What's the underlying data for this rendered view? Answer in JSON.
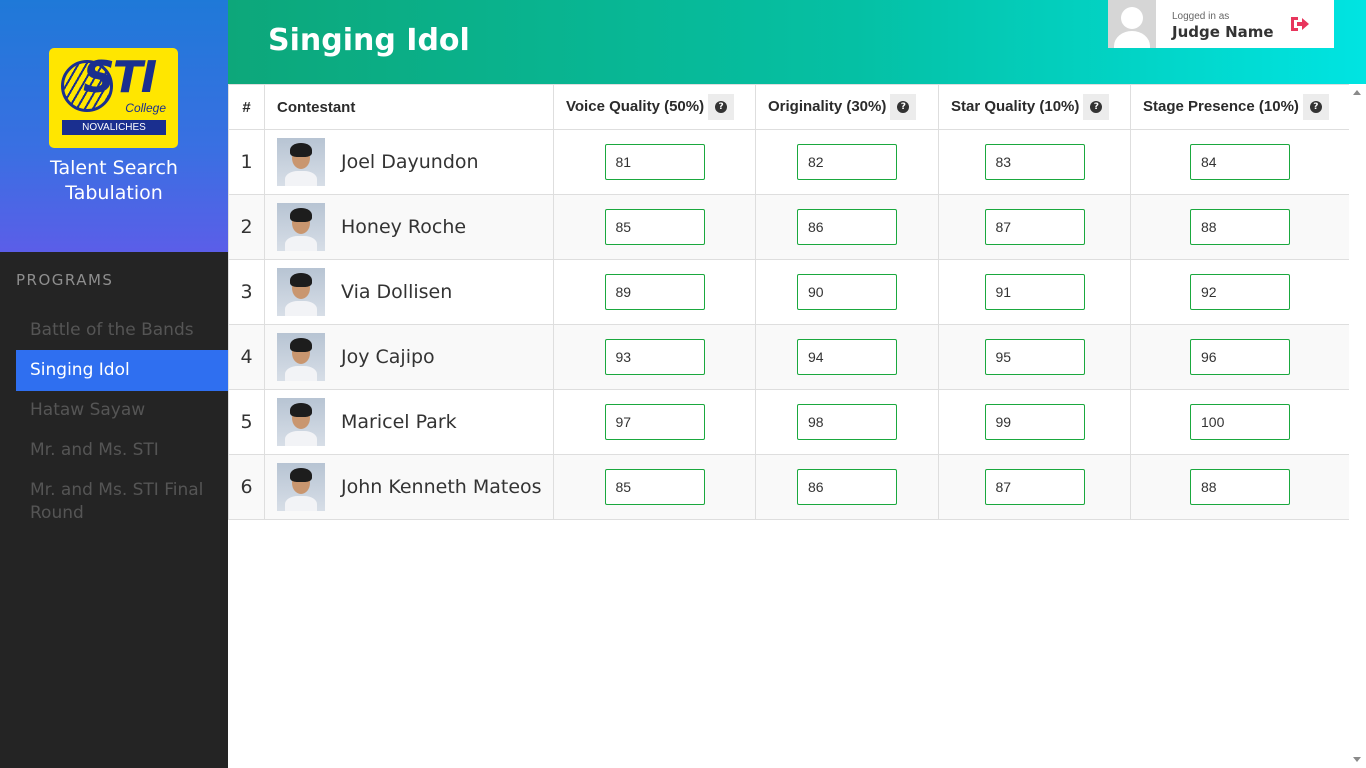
{
  "brand": {
    "logo_text": "STI",
    "logo_subtext": "College",
    "logo_campus": "NOVALICHES",
    "title_line1": "Talent Search",
    "title_line2": "Tabulation"
  },
  "sidebar": {
    "section_label": "PROGRAMS",
    "items": [
      {
        "label": "Battle of the Bands"
      },
      {
        "label": "Singing Idol"
      },
      {
        "label": "Hataw Sayaw"
      },
      {
        "label": "Mr. and Ms. STI"
      },
      {
        "label": "Mr. and Ms. STI Final Round"
      }
    ],
    "active_item": "Singing Idol"
  },
  "header": {
    "title": "Singing Idol",
    "user": {
      "logged_label": "Logged in as",
      "name": "Judge Name"
    }
  },
  "table": {
    "columns": {
      "number": "#",
      "contestant": "Contestant",
      "criteria": [
        {
          "label": "Voice Quality (50%)"
        },
        {
          "label": "Originality (30%)"
        },
        {
          "label": "Star Quality (10%)"
        },
        {
          "label": "Stage Presence (10%)"
        }
      ]
    },
    "rows": [
      {
        "number": "1",
        "name": "Joel Dayundon",
        "scores": [
          "81",
          "82",
          "83",
          "84"
        ]
      },
      {
        "number": "2",
        "name": "Honey Roche",
        "scores": [
          "85",
          "86",
          "87",
          "88"
        ]
      },
      {
        "number": "3",
        "name": "Via Dollisen",
        "scores": [
          "89",
          "90",
          "91",
          "92"
        ]
      },
      {
        "number": "4",
        "name": "Joy Cajipo",
        "scores": [
          "93",
          "94",
          "95",
          "96"
        ]
      },
      {
        "number": "5",
        "name": "Maricel Park",
        "scores": [
          "97",
          "98",
          "99",
          "100"
        ]
      },
      {
        "number": "6",
        "name": "John Kenneth Mateos",
        "scores": [
          "85",
          "86",
          "87",
          "88"
        ]
      }
    ]
  },
  "colors": {
    "sidebar_bg": "#242424",
    "active_nav": "#2f6ff0",
    "header_gradient_start": "#0da77a",
    "header_gradient_end": "#00e4e2",
    "score_border": "#1aa83e",
    "logout_icon": "#e8365d"
  },
  "icons": {
    "help": "question-circle-icon",
    "logout": "sign-out-icon",
    "avatar": "user-placeholder-icon"
  }
}
